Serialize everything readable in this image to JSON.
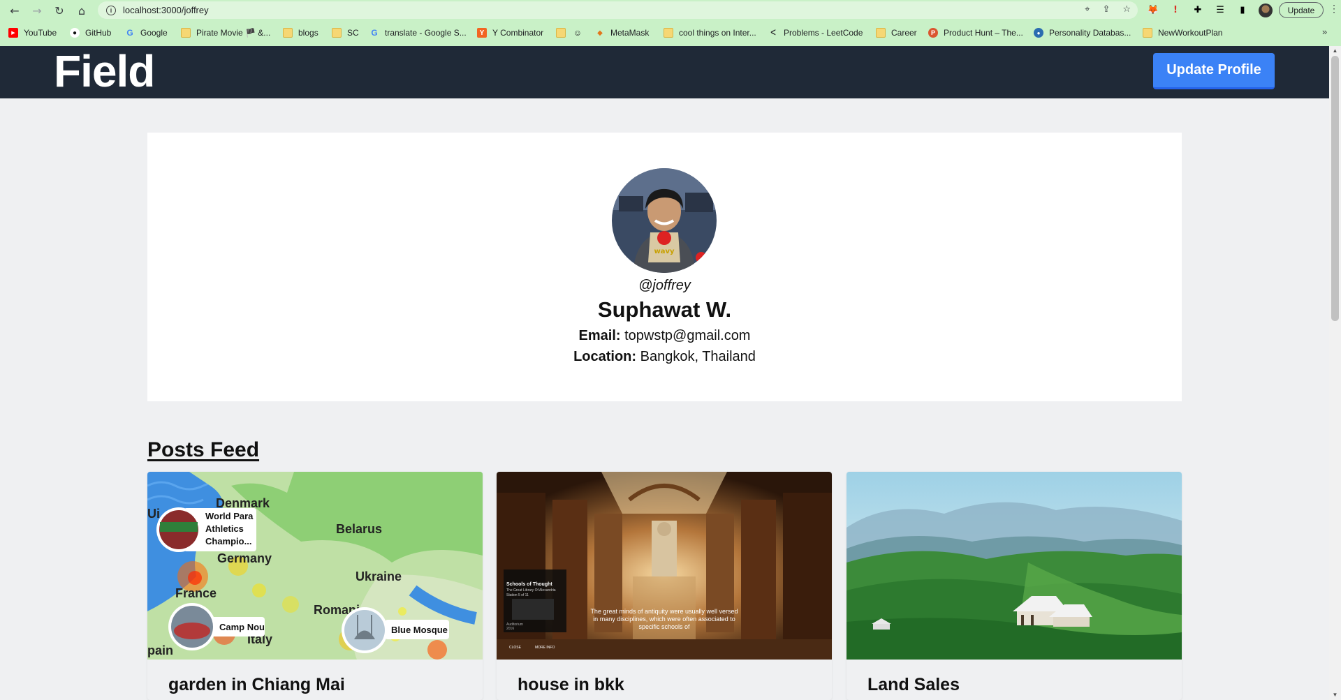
{
  "browser": {
    "url": "localhost:3000/joffrey",
    "update_label": "Update",
    "bookmarks": [
      {
        "label": "YouTube",
        "icon": "youtube-icon"
      },
      {
        "label": "GitHub",
        "icon": "github-icon"
      },
      {
        "label": "Google",
        "icon": "google-icon"
      },
      {
        "label": "Pirate Movie 🏴 &...",
        "icon": "folder-icon"
      },
      {
        "label": "blogs",
        "icon": "folder-icon"
      },
      {
        "label": "SC",
        "icon": "folder-icon"
      },
      {
        "label": "translate - Google S...",
        "icon": "google-icon"
      },
      {
        "label": "Y Combinator",
        "icon": "ycombinator-icon"
      },
      {
        "label": "",
        "icon": "folder-icon"
      },
      {
        "label": "",
        "icon": "smiley-icon"
      },
      {
        "label": "MetaMask",
        "icon": "metamask-icon"
      },
      {
        "label": "cool things on Inter...",
        "icon": "folder-icon"
      },
      {
        "label": "Problems - LeetCode",
        "icon": "leetcode-icon"
      },
      {
        "label": "Career",
        "icon": "folder-icon"
      },
      {
        "label": "Product Hunt – The...",
        "icon": "producthunt-icon"
      },
      {
        "label": "Personality Databas...",
        "icon": "personality-db-icon"
      },
      {
        "label": "NewWorkoutPlan",
        "icon": "folder-icon"
      }
    ]
  },
  "header": {
    "logo": "Field",
    "update_profile_label": "Update Profile"
  },
  "profile": {
    "username": "@joffrey",
    "full_name": "Suphawat W.",
    "email_label": "Email:",
    "email": "topwstp@gmail.com",
    "location_label": "Location:",
    "location": "Bangkok, Thailand"
  },
  "feed": {
    "title": "Posts Feed",
    "posts": [
      {
        "title": "garden in Chiang Mai",
        "map_labels": {
          "denmark": "Denmark",
          "belarus": "Belarus",
          "germany": "Germany",
          "ukraine": "Ukraine",
          "france": "France",
          "romania": "Romani",
          "italy": "Italy",
          "spain": "pain",
          "uk": "Ui",
          "pin1": "World Para Athletics Champio...",
          "pin2": "Camp Nou",
          "pin3": "Blue Mosque"
        }
      },
      {
        "title": "house in bkk",
        "overlay": {
          "heading": "Schools of Thought",
          "sub1": "The Great Library Of Alexandria",
          "sub2": "Station 5 of 11",
          "room": "Auditorium",
          "year": "2016",
          "close": "CLOSE",
          "more": "MORE INFO",
          "caption": "The great minds of antiquity were usually well versed in many disciplines, which were often associated to specific schools of"
        }
      },
      {
        "title": "Land Sales"
      }
    ]
  },
  "colors": {
    "chrome": "#c9f1c7",
    "header_bg": "#1f2937",
    "button": "#3b82f6",
    "page_bg": "#eff0f2"
  }
}
